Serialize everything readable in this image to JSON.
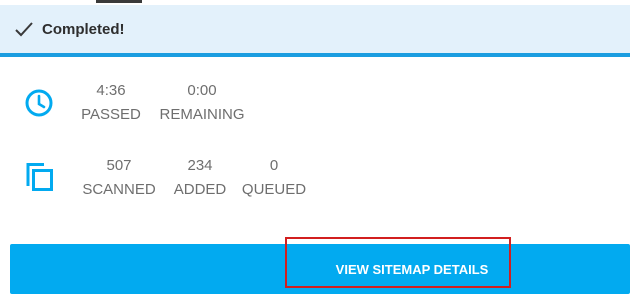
{
  "status": {
    "icon": "checkmark-icon",
    "text": "Completed!"
  },
  "time": {
    "icon": "clock-icon",
    "passed_value": "4:36",
    "passed_label": "PASSED",
    "remaining_value": "0:00",
    "remaining_label": "REMAINING"
  },
  "pages": {
    "icon": "copy-icon",
    "scanned_value": "507",
    "scanned_label": "SCANNED",
    "added_value": "234",
    "added_label": "ADDED",
    "queued_value": "0",
    "queued_label": "QUEUED"
  },
  "actions": {
    "view_details_label": "VIEW SITEMAP DETAILS"
  },
  "colors": {
    "accent": "#02aaf0",
    "status_bg": "#e3f1fb",
    "status_border": "#1b9de0",
    "highlight": "#d21f1f"
  }
}
